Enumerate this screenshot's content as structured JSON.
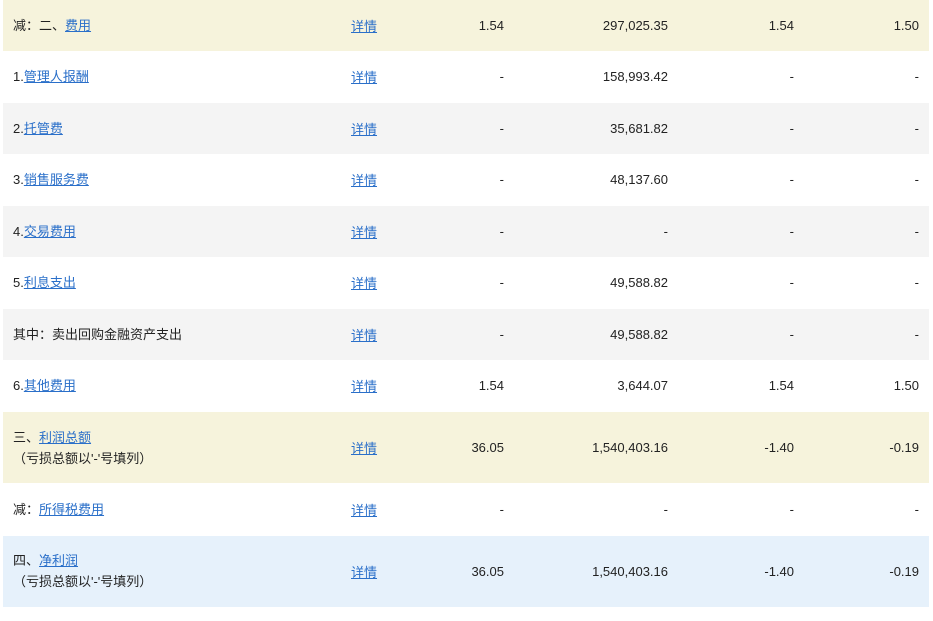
{
  "rows": [
    {
      "prefix": "减：二、",
      "link": "费用",
      "sub": "",
      "detail": "详情",
      "v1": "1.54",
      "v2": "297,025.35",
      "v3": "1.54",
      "v4": "1.50"
    },
    {
      "prefix": "1.",
      "link": "管理人报酬",
      "sub": "",
      "detail": "详情",
      "v1": "-",
      "v2": "158,993.42",
      "v3": "-",
      "v4": "-"
    },
    {
      "prefix": "2.",
      "link": "托管费",
      "sub": "",
      "detail": "详情",
      "v1": "-",
      "v2": "35,681.82",
      "v3": "-",
      "v4": "-"
    },
    {
      "prefix": "3.",
      "link": "销售服务费",
      "sub": "",
      "detail": "详情",
      "v1": "-",
      "v2": "48,137.60",
      "v3": "-",
      "v4": "-"
    },
    {
      "prefix": "4.",
      "link": "交易费用",
      "sub": "",
      "detail": "详情",
      "v1": "-",
      "v2": "-",
      "v3": "-",
      "v4": "-"
    },
    {
      "prefix": "5.",
      "link": "利息支出",
      "sub": "",
      "detail": "详情",
      "v1": "-",
      "v2": "49,588.82",
      "v3": "-",
      "v4": "-"
    },
    {
      "prefix": "其中：卖出回购金融资产支出",
      "link": "",
      "sub": "",
      "detail": "详情",
      "v1": "-",
      "v2": "49,588.82",
      "v3": "-",
      "v4": "-"
    },
    {
      "prefix": "6.",
      "link": "其他费用",
      "sub": "",
      "detail": "详情",
      "v1": "1.54",
      "v2": "3,644.07",
      "v3": "1.54",
      "v4": "1.50"
    },
    {
      "prefix": "三、",
      "link": "利润总额",
      "sub": "（亏损总额以'-'号填列）",
      "detail": "详情",
      "v1": "36.05",
      "v2": "1,540,403.16",
      "v3": "-1.40",
      "v4": "-0.19"
    },
    {
      "prefix": "减：",
      "link": "所得税费用",
      "sub": "",
      "detail": "详情",
      "v1": "-",
      "v2": "-",
      "v3": "-",
      "v4": "-"
    },
    {
      "prefix": "四、",
      "link": "净利润",
      "sub": "（亏损总额以'-'号填列）",
      "detail": "详情",
      "v1": "36.05",
      "v2": "1,540,403.16",
      "v3": "-1.40",
      "v4": "-0.19"
    }
  ]
}
